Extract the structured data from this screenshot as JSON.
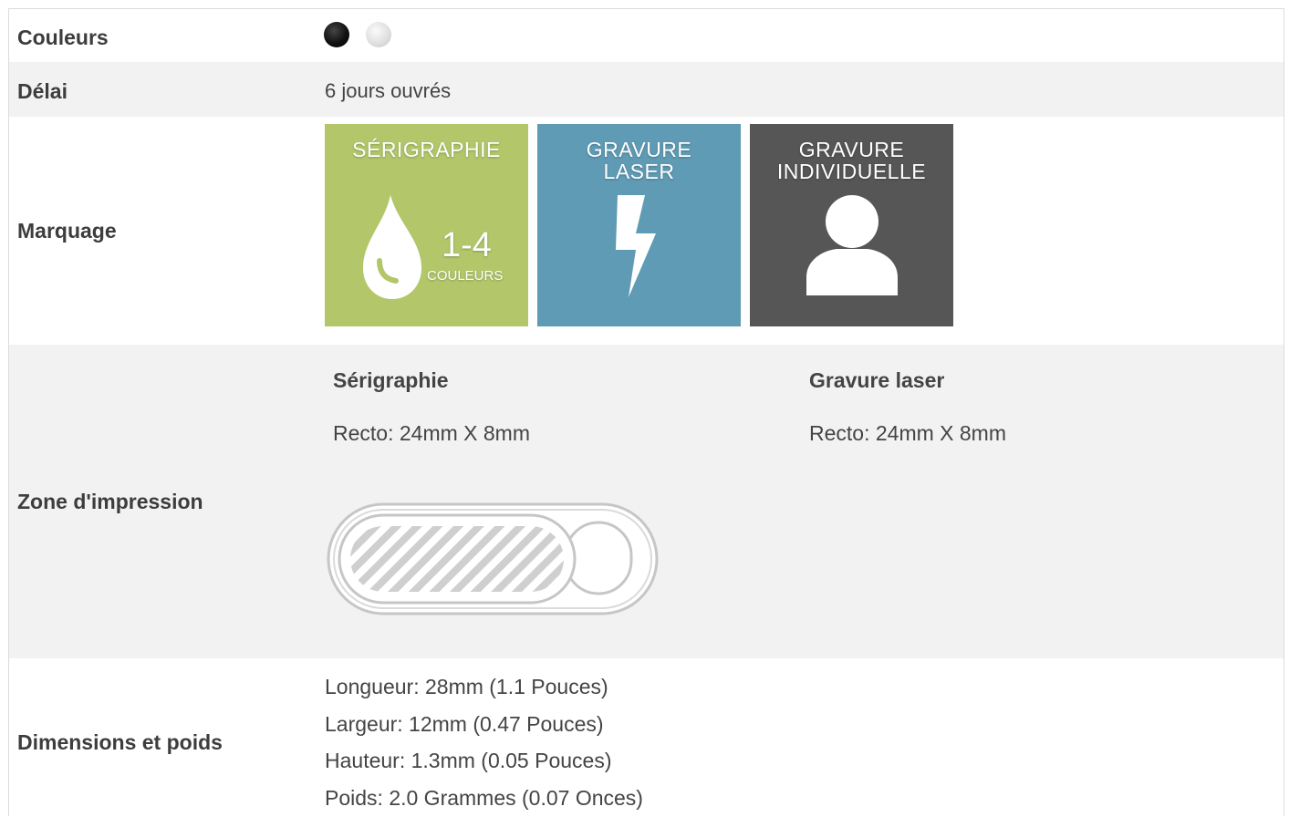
{
  "colors_row": {
    "label": "Couleurs",
    "swatches": [
      {
        "name": "black",
        "color": "#111111"
      },
      {
        "name": "silver",
        "color": "#e0e0e0"
      }
    ]
  },
  "delay_row": {
    "label": "Délai",
    "value": "6 jours ouvrés"
  },
  "marking_row": {
    "label": "Marquage",
    "options": [
      {
        "title": "SÉRIGRAPHIE",
        "number": "1-4",
        "caption": "COULEURS",
        "icon": "drop-icon",
        "color": "#b3c66a"
      },
      {
        "title_line1": "GRAVURE",
        "title_line2": "LASER",
        "icon": "lightning-icon",
        "color": "#5f9bb4"
      },
      {
        "title_line1": "GRAVURE",
        "title_line2": "INDIVIDUELLE",
        "icon": "person-icon",
        "color": "#565656"
      }
    ]
  },
  "zone_row": {
    "label": "Zone d'impression",
    "methods": [
      {
        "title": "Sérigraphie",
        "recto": "Recto: 24mm X 8mm"
      },
      {
        "title": "Gravure laser",
        "recto": "Recto: 24mm X 8mm"
      }
    ],
    "diagram_icon": "webcam-cover-icon"
  },
  "dimensions_row": {
    "label": "Dimensions et poids",
    "lines": [
      "Longueur: 28mm (1.1 Pouces)",
      "Largeur: 12mm (0.47 Pouces)",
      "Hauteur: 1.3mm (0.05 Pouces)",
      "Poids: 2.0 Grammes (0.07 Onces)"
    ]
  }
}
